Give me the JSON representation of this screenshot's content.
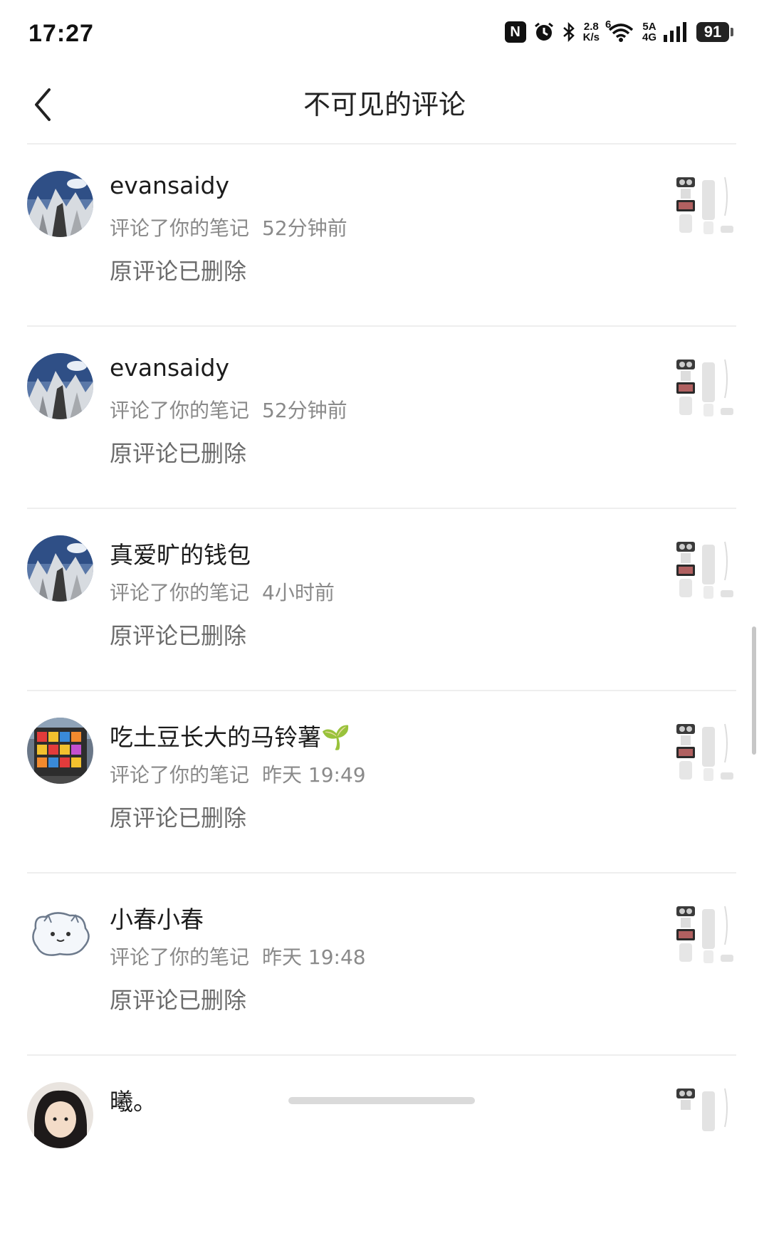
{
  "status_bar": {
    "time": "17:27",
    "nfc_label": "N",
    "speed_top": "2.8",
    "speed_bottom": "K/s",
    "wifi_label": "6",
    "net_top": "5A",
    "net_bottom": "4G",
    "battery": "91"
  },
  "header": {
    "title": "不可见的评论",
    "back_icon": "chevron-left-icon"
  },
  "items": [
    {
      "username": "evansaidy",
      "action": "评论了你的笔记",
      "time": "52分钟前",
      "content": "原评论已删除",
      "avatar": "mountain-avatar"
    },
    {
      "username": "evansaidy",
      "action": "评论了你的笔记",
      "time": "52分钟前",
      "content": "原评论已删除",
      "avatar": "mountain-avatar"
    },
    {
      "username": "真爱旷的钱包",
      "action": "评论了你的笔记",
      "time": "4小时前",
      "content": "原评论已删除",
      "avatar": "mountain-avatar"
    },
    {
      "username": "吃土豆长大的马铃薯🌱",
      "action": "评论了你的笔记",
      "time": "昨天 19:49",
      "content": "原评论已删除",
      "avatar": "colorful-building-avatar"
    },
    {
      "username": "小春小春",
      "action": "评论了你的笔记",
      "time": "昨天 19:48",
      "content": "原评论已删除",
      "avatar": "cartoon-cat-avatar"
    },
    {
      "username": "曦。",
      "action": "",
      "time": "",
      "content": "",
      "avatar": "girl-avatar"
    }
  ],
  "colors": {
    "background": "#ffffff",
    "divider": "#eeeeee",
    "secondary_text": "#8a8a8a"
  }
}
